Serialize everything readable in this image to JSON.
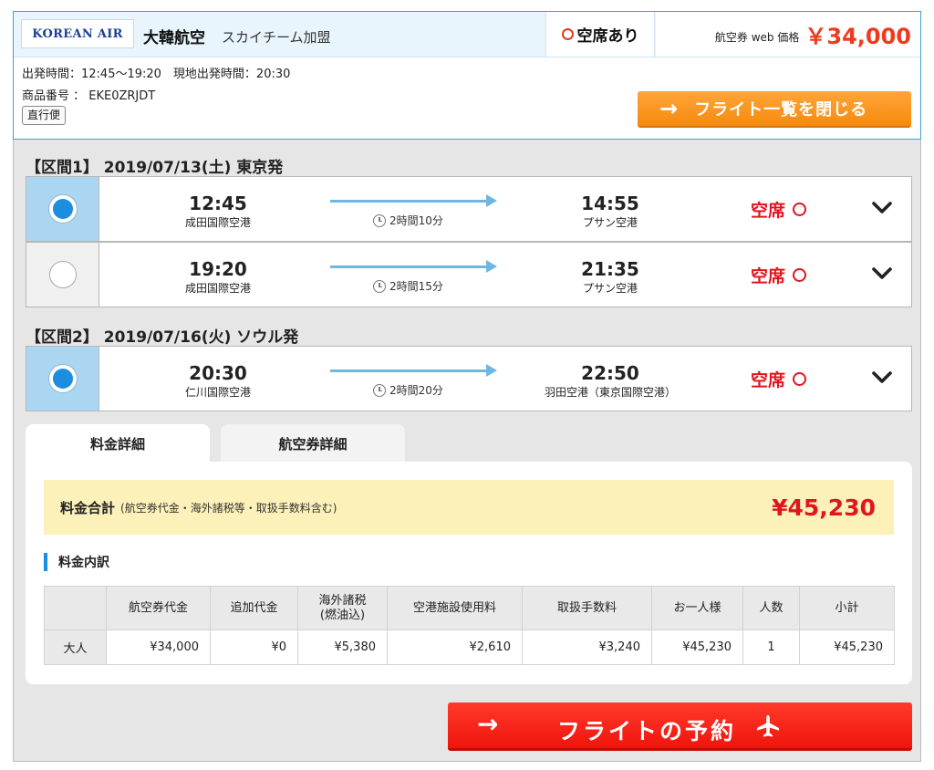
{
  "header": {
    "logo_text": "KOREAN AIR",
    "airline_name": "大韓航空",
    "alliance": "スカイチーム加盟",
    "seat_status": "空席あり",
    "price_label": "航空券 web 価格",
    "price": "￥34,000",
    "times_line": "出発時間：12:45〜19:20　現地出発時間：20:30",
    "product_code_line": "商品番号 ： EKE0ZRJDT",
    "direct_chip": "直行便",
    "close_button": "フライト一覧を閉じる"
  },
  "segments": [
    {
      "title": "【区間1】 2019/07/13(土) 東京発",
      "flights": [
        {
          "selected": true,
          "dep_time": "12:45",
          "dep_airport": "成田国際空港",
          "duration": "2時間10分",
          "arr_time": "14:55",
          "arr_airport": "プサン空港",
          "availability": "空席"
        },
        {
          "selected": false,
          "dep_time": "19:20",
          "dep_airport": "成田国際空港",
          "duration": "2時間15分",
          "arr_time": "21:35",
          "arr_airport": "プサン空港",
          "availability": "空席"
        }
      ]
    },
    {
      "title": "【区間2】 2019/07/16(火) ソウル発",
      "flights": [
        {
          "selected": true,
          "dep_time": "20:30",
          "dep_airport": "仁川国際空港",
          "duration": "2時間20分",
          "arr_time": "22:50",
          "arr_airport": "羽田空港（東京国際空港）",
          "availability": "空席"
        }
      ]
    }
  ],
  "tabs": [
    {
      "label": "料金詳細",
      "active": true
    },
    {
      "label": "航空券詳細",
      "active": false
    }
  ],
  "fare": {
    "total_label": "料金合計",
    "total_note": "(航空券代金・海外諸税等・取扱手数料含む)",
    "total_value": "¥45,230",
    "breakdown_label": "料金内訳",
    "columns": [
      "",
      "航空券代金",
      "追加代金",
      "海外諸税\n(燃油込)",
      "空港施設使用料",
      "取扱手数料",
      "お一人様",
      "人数",
      "小計"
    ],
    "rows": [
      [
        "大人",
        "¥34,000",
        "¥0",
        "¥5,380",
        "¥2,610",
        "¥3,240",
        "¥45,230",
        "1",
        "¥45,230"
      ]
    ]
  },
  "reserve_button": "フライトの予約",
  "icons": {
    "arrow": "→",
    "chevron": "chevron-down-icon",
    "plane": "airplane-icon",
    "clock": "clock-icon"
  },
  "colors": {
    "accent_blue": "#1c8ee0",
    "price_red": "#ee3a1f",
    "orange_button": "#f58a0e",
    "red_button": "#f0140c",
    "total_bg": "#fcf1b8"
  }
}
